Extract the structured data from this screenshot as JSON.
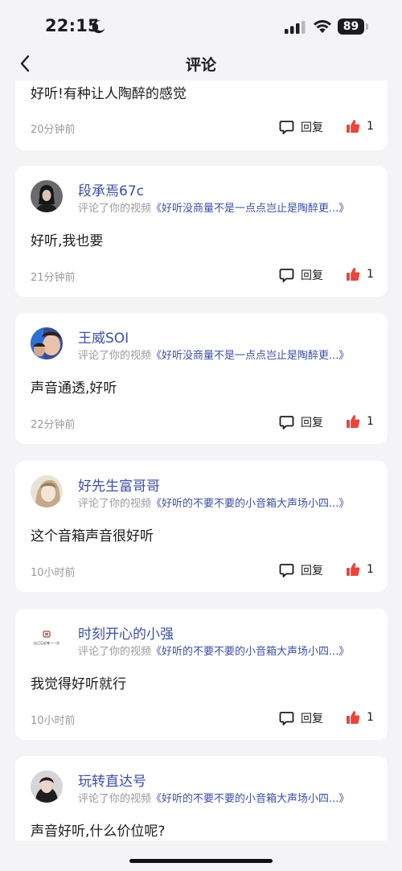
{
  "status_bar": {
    "time": "22:15",
    "battery": "89"
  },
  "nav": {
    "title": "评论"
  },
  "cards": [
    {
      "comment": "好听!有种让人陶醉的感觉",
      "time": "20分钟前",
      "reply_label": "回复",
      "like_count": "1"
    },
    {
      "username": "段承焉67c",
      "action_text": "评论了你的视频",
      "video_title": "《好听没商量不是一点点岂止是陶醉更...》",
      "comment": "好听,我也要",
      "time": "21分钟前",
      "reply_label": "回复",
      "like_count": "1"
    },
    {
      "username": "王威SOI",
      "action_text": "评论了你的视频",
      "video_title": "《好听没商量不是一点点岂止是陶醉更...》",
      "comment": "声音通透,好听",
      "time": "22分钟前",
      "reply_label": "回复",
      "like_count": "1"
    },
    {
      "username": "好先生富哥哥",
      "action_text": "评论了你的视频",
      "video_title": "《好听的不要不要的小音箱大声场小四...》",
      "comment": "这个音箱声音很好听",
      "time": "10小时前",
      "reply_label": "回复",
      "like_count": "1"
    },
    {
      "username": "时刻开心的小强",
      "action_text": "评论了你的视频",
      "video_title": "《好听的不要不要的小音箱大声场小四...》",
      "avatar_text": "自己见证唯一一次",
      "comment": "我觉得好听就行",
      "time": "10小时前",
      "reply_label": "回复",
      "like_count": "1"
    },
    {
      "username": "玩转直达号",
      "action_text": "评论了你的视频",
      "video_title": "《好听的不要不要的小音箱大声场小四...》",
      "comment": "声音好听,什么价位呢?"
    }
  ],
  "colors": {
    "background": "#f4f4f6",
    "card": "#ffffff",
    "username": "#3d4fa8",
    "secondary_text": "#9a9aa0",
    "like_red": "#e8453c"
  },
  "icons": [
    "back-chevron-icon",
    "moon-icon",
    "signal-icon",
    "wifi-icon",
    "battery-icon",
    "comment-bubble-icon",
    "thumbs-up-icon"
  ]
}
